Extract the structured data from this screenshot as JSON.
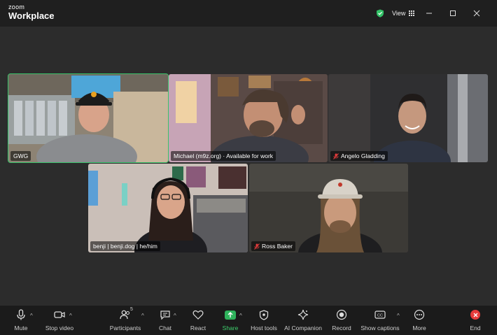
{
  "app": {
    "brand_top": "zoom",
    "brand_main": "Workplace",
    "view_label": "View"
  },
  "participants": [
    {
      "name": "GWG",
      "active": true,
      "muted": false
    },
    {
      "name": "Michael (m9z.org) · Available for work",
      "active": false,
      "muted": false
    },
    {
      "name": "Angelo Gladding",
      "active": false,
      "muted": true
    },
    {
      "name": "benji | benji.dog | he/him",
      "active": false,
      "muted": false
    },
    {
      "name": "Ross Baker",
      "active": false,
      "muted": true
    }
  ],
  "toolbar": {
    "mute": "Mute",
    "stop_video": "Stop video",
    "participants": "Participants",
    "participants_count": "5",
    "chat": "Chat",
    "react": "React",
    "share": "Share",
    "host_tools": "Host tools",
    "ai_companion": "AI Companion",
    "record": "Record",
    "captions": "Show captions",
    "more": "More",
    "end": "End"
  },
  "colors": {
    "accent_green": "#39c26a",
    "end_red": "#e63b3b",
    "mute_red": "#e23b3b"
  }
}
